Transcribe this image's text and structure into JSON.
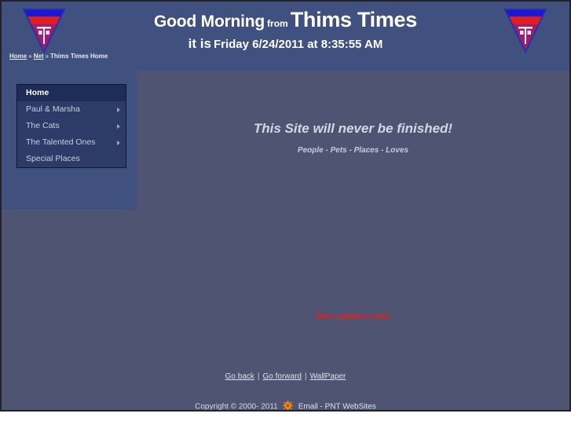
{
  "header": {
    "greeting": "Good Morning",
    "from_word": "from",
    "brand": "Thims Times",
    "it_is": "it is",
    "datetime": "Friday 6/24/2011 at 8:35:55 AM",
    "logo_alt": "pnt-triangle-logo"
  },
  "breadcrumb": {
    "items": [
      {
        "label": "Home",
        "link": true
      },
      {
        "label": "Net",
        "link": true
      },
      {
        "label": "Thims Times Home",
        "link": false
      }
    ],
    "separator": "»"
  },
  "sidebar": {
    "items": [
      {
        "label": "Home",
        "active": true,
        "has_submenu": false
      },
      {
        "label": "Paul & Marsha",
        "active": false,
        "has_submenu": true
      },
      {
        "label": "The Cats",
        "active": false,
        "has_submenu": true
      },
      {
        "label": "The Talented Ones",
        "active": false,
        "has_submenu": true
      },
      {
        "label": "Special Places",
        "active": false,
        "has_submenu": false
      }
    ]
  },
  "main": {
    "headline": "This Site will never be finished!",
    "subline": "People - Pets - Places - Loves",
    "updates_notice": "More updates soon!"
  },
  "footer": {
    "links": [
      {
        "label": "Go back"
      },
      {
        "label": "Go forward"
      },
      {
        "label": "WallPaper"
      }
    ],
    "separator": "|",
    "copyright": "Copyright © 2000- 2011",
    "email_link": "Email - PNT WebSites",
    "copyright_icon": "spiderweb-icon"
  },
  "colors": {
    "header_bg": "#41517f",
    "body_bg": "#4e5471",
    "menu_bg": "#2c3b68",
    "menu_active_bg": "#1e2d57",
    "notice_red": "#ee1c18",
    "logo_blue": "#1a18d8",
    "logo_red": "#e01e1e",
    "logo_magenta": "#9c1f6e"
  }
}
